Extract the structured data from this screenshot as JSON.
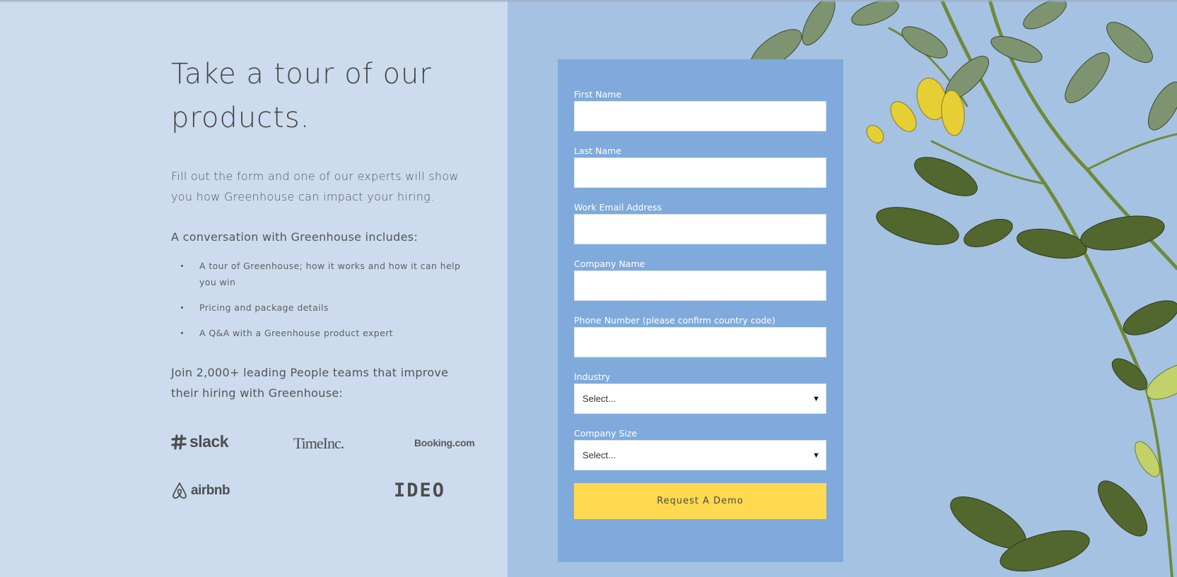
{
  "hero": {
    "title": "Take a tour of our products.",
    "intro": "Fill out the form and one of our experts will show you how Greenhouse can impact your hiring.",
    "conversation_heading": "A conversation with Greenhouse includes:",
    "bullets": [
      "A tour of Greenhouse; how it works and how it can help you win",
      "Pricing and package details",
      "A Q&A with a Greenhouse product expert"
    ],
    "join_text": "Join 2,000+ leading People teams that improve their hiring with Greenhouse:"
  },
  "logos": {
    "slack": "slack",
    "timeinc": "TimeInc.",
    "booking": "Booking.com",
    "airbnb": "airbnb",
    "ideo": "IDEO"
  },
  "form": {
    "first_name": "First Name",
    "last_name": "Last Name",
    "work_email": "Work Email Address",
    "company_name": "Company Name",
    "phone": "Phone Number (please confirm country code)",
    "industry_label": "Industry",
    "industry_value": "Select...",
    "company_size_label": "Company Size",
    "company_size_value": "Select...",
    "submit": "Request A Demo"
  },
  "icons": {
    "select_caret": "triangle-down-icon",
    "slack": "slack-hash-icon",
    "airbnb": "airbnb-belo-icon"
  },
  "colors": {
    "left_bg": "#ccdcee",
    "right_bg": "#a6c2e2",
    "form_bg": "#7faadb",
    "submit_bg": "#ffd94f",
    "text": "#4a4a4a"
  }
}
